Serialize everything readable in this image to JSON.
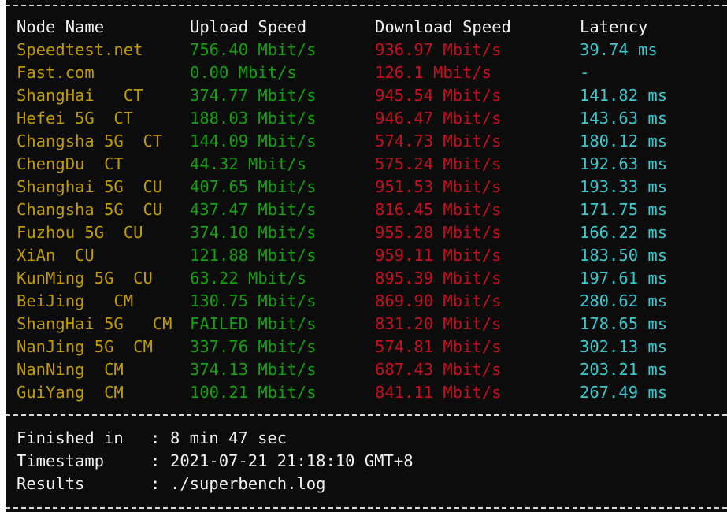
{
  "header": {
    "node_name": "Node Name",
    "upload_speed": "Upload Speed",
    "download_speed": "Download Speed",
    "latency": "Latency"
  },
  "rows": [
    {
      "node": "Speedtest.net",
      "upload": "756.40 Mbit/s",
      "download": "936.97 Mbit/s",
      "latency": "39.74 ms"
    },
    {
      "node": "Fast.com",
      "upload": "0.00 Mbit/s",
      "download": "126.1 Mbit/s",
      "latency": "-"
    },
    {
      "node": "ShangHai   CT",
      "upload": "374.77 Mbit/s",
      "download": "945.54 Mbit/s",
      "latency": "141.82 ms"
    },
    {
      "node": "Hefei 5G  CT",
      "upload": "188.03 Mbit/s",
      "download": "946.47 Mbit/s",
      "latency": "143.63 ms"
    },
    {
      "node": "Changsha 5G  CT",
      "upload": "144.09 Mbit/s",
      "download": "574.73 Mbit/s",
      "latency": "180.12 ms"
    },
    {
      "node": "ChengDu  CT",
      "upload": "44.32 Mbit/s",
      "download": "575.24 Mbit/s",
      "latency": "192.63 ms"
    },
    {
      "node": "Shanghai 5G  CU",
      "upload": "407.65 Mbit/s",
      "download": "951.53 Mbit/s",
      "latency": "193.33 ms"
    },
    {
      "node": "Changsha 5G  CU",
      "upload": "437.47 Mbit/s",
      "download": "816.45 Mbit/s",
      "latency": "171.75 ms"
    },
    {
      "node": "Fuzhou 5G  CU",
      "upload": "374.10 Mbit/s",
      "download": "955.28 Mbit/s",
      "latency": "166.22 ms"
    },
    {
      "node": "XiAn  CU",
      "upload": "121.88 Mbit/s",
      "download": "959.11 Mbit/s",
      "latency": "183.50 ms"
    },
    {
      "node": "KunMing 5G  CU",
      "upload": "63.22 Mbit/s",
      "download": "895.39 Mbit/s",
      "latency": "197.61 ms"
    },
    {
      "node": "BeiJing   CM",
      "upload": "130.75 Mbit/s",
      "download": "869.90 Mbit/s",
      "latency": "280.62 ms"
    },
    {
      "node": "ShangHai 5G   CM",
      "upload": "FAILED Mbit/s",
      "download": "831.20 Mbit/s",
      "latency": "178.65 ms"
    },
    {
      "node": "NanJing 5G  CM",
      "upload": "337.76 Mbit/s",
      "download": "574.81 Mbit/s",
      "latency": "302.13 ms"
    },
    {
      "node": "NanNing  CM",
      "upload": "374.13 Mbit/s",
      "download": "687.43 Mbit/s",
      "latency": "203.21 ms"
    },
    {
      "node": "GuiYang  CM",
      "upload": "100.21 Mbit/s",
      "download": "841.11 Mbit/s",
      "latency": "267.49 ms"
    }
  ],
  "summary": {
    "finished_label": "Finished in",
    "finished_value": "8 min 47 sec",
    "timestamp_label": "Timestamp",
    "timestamp_value": "2021-07-21 21:18:10 GMT+8",
    "results_label": "Results",
    "results_value": "./superbench.log",
    "separator": ":"
  },
  "colors": {
    "background": "#0c0c0c",
    "node": "#c19c00",
    "upload": "#13a10e",
    "download": "#c50f1f",
    "latency": "#3ac8cf",
    "text": "#f2f2f2"
  }
}
